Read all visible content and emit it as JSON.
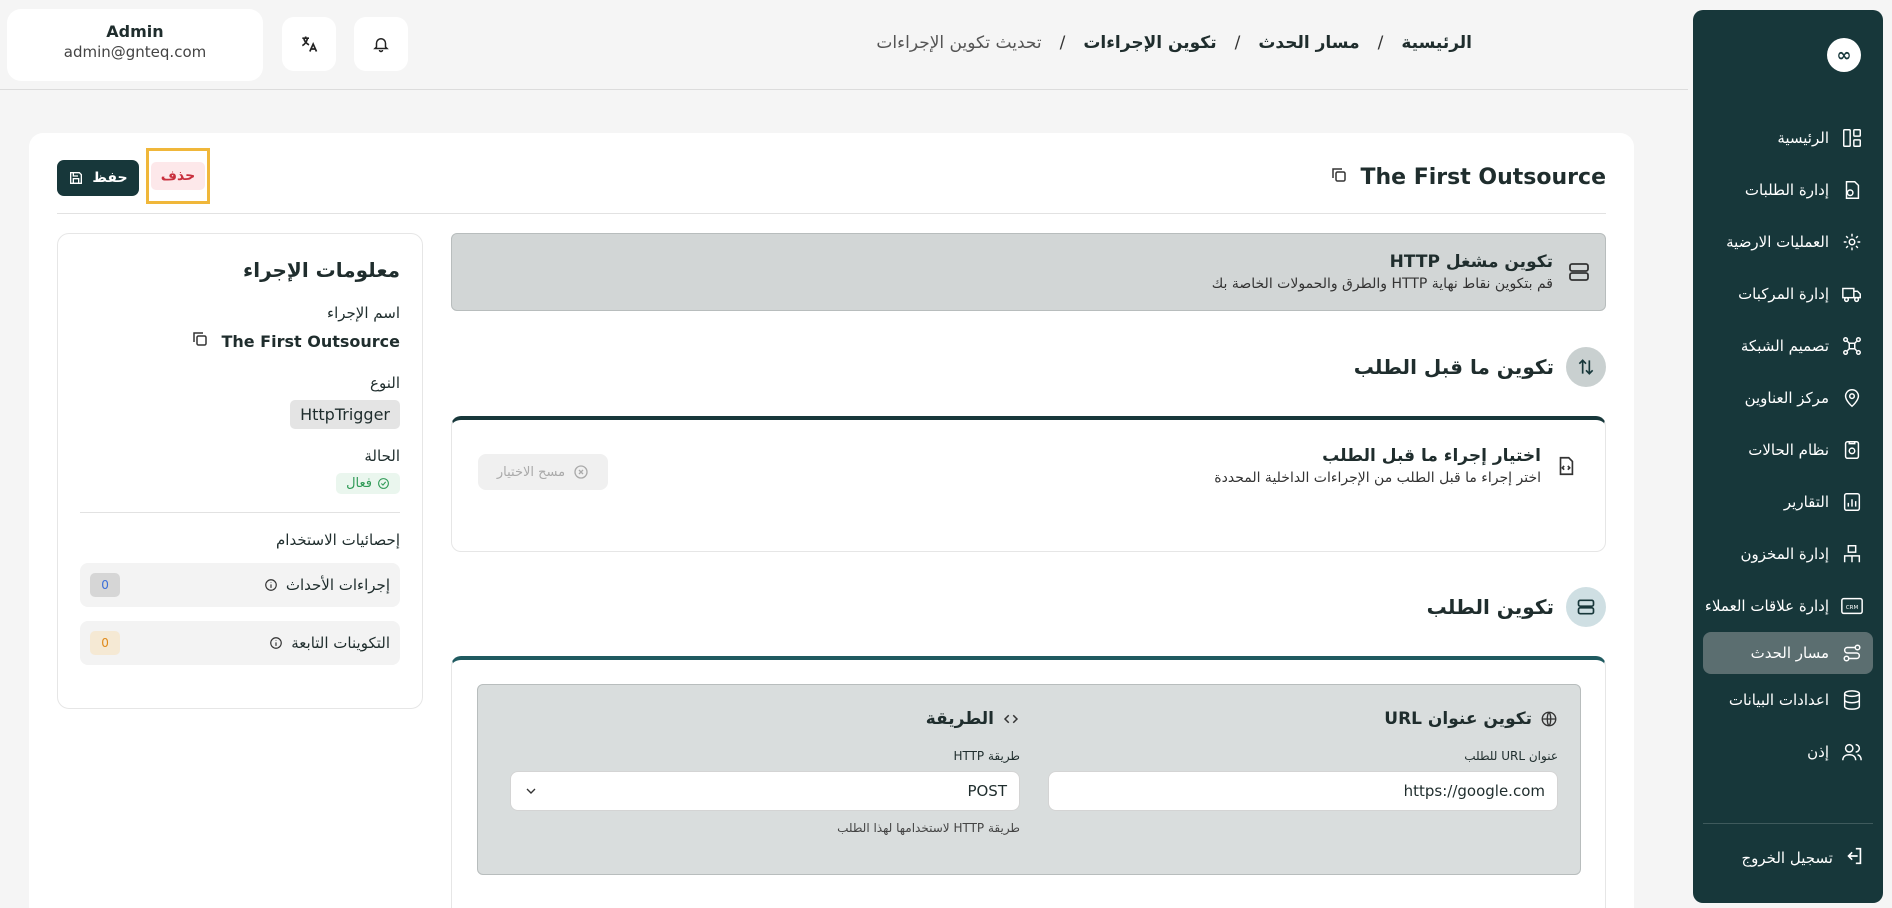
{
  "user": {
    "name": "Admin",
    "email": "admin@gnteq.com"
  },
  "breadcrumb": {
    "home": "الرئيسية",
    "event_path": "مسار الحدث",
    "actions_config": "تكوين الإجراءات",
    "current": "تحديث تكوين الإجراءات"
  },
  "sidebar": {
    "items": [
      {
        "label": "الرئيسية",
        "icon": "dashboard-icon"
      },
      {
        "label": "إدارة الطلبات",
        "icon": "orders-icon"
      },
      {
        "label": "العمليات الارضية",
        "icon": "operations-icon"
      },
      {
        "label": "إدارة المركبات",
        "icon": "truck-icon"
      },
      {
        "label": "تصميم الشبكة",
        "icon": "network-icon"
      },
      {
        "label": "مركز العناوين",
        "icon": "location-icon"
      },
      {
        "label": "نظام الحالات",
        "icon": "status-icon"
      },
      {
        "label": "التقارير",
        "icon": "reports-icon"
      },
      {
        "label": "إدارة المخزون",
        "icon": "inventory-icon"
      },
      {
        "label": "إدارة علاقات العملاء",
        "icon": "crm-icon"
      },
      {
        "label": "مسار الحدث",
        "icon": "event-path-icon",
        "active": true
      },
      {
        "label": "اعدادات البيانات",
        "icon": "database-icon"
      },
      {
        "label": "إذن",
        "icon": "users-icon"
      }
    ],
    "logout": "تسجيل الخروج"
  },
  "page": {
    "title": "The First Outsource",
    "save": "حفظ",
    "delete": "حذف"
  },
  "info": {
    "heading": "معلومات الإجراء",
    "name_label": "اسم الإجراء",
    "name_value": "The First Outsource",
    "type_label": "النوع",
    "type_value": "HttpTrigger",
    "status_label": "الحالة",
    "status_value": "فعال",
    "stats_heading": "إحصائيات الاستخدام",
    "stats": [
      {
        "label": "إجراءات الأحداث",
        "value": "0"
      },
      {
        "label": "التكوينات التابعة",
        "value": "0"
      }
    ]
  },
  "banner": {
    "title": "تكوين مشغل HTTP",
    "subtitle": "قم بتكوين نقاط نهاية HTTP والطرق والحمولات الخاصة بك"
  },
  "pre_request": {
    "heading": "تكوين ما قبل الطلب",
    "select_title": "اختيار إجراء ما قبل الطلب",
    "select_subtitle": "اختر إجراء ما قبل الطلب من الإجراءات الداخلية المحددة",
    "clear": "مسح الاختيار"
  },
  "request": {
    "heading": "تكوين الطلب",
    "url_heading": "تكوين عنوان URL",
    "url_label": "عنوان URL للطلب",
    "url_value": "https://google.com",
    "method_heading": "الطريقة",
    "method_label": "طريقة HTTP",
    "method_value": "POST",
    "method_hint": "طريقة HTTP لاستخدامها لهذا الطلب"
  },
  "colors": {
    "primary": "#17373a",
    "danger": "#c9303e",
    "success": "#2f9a56",
    "highlight": "#f0b73a"
  }
}
